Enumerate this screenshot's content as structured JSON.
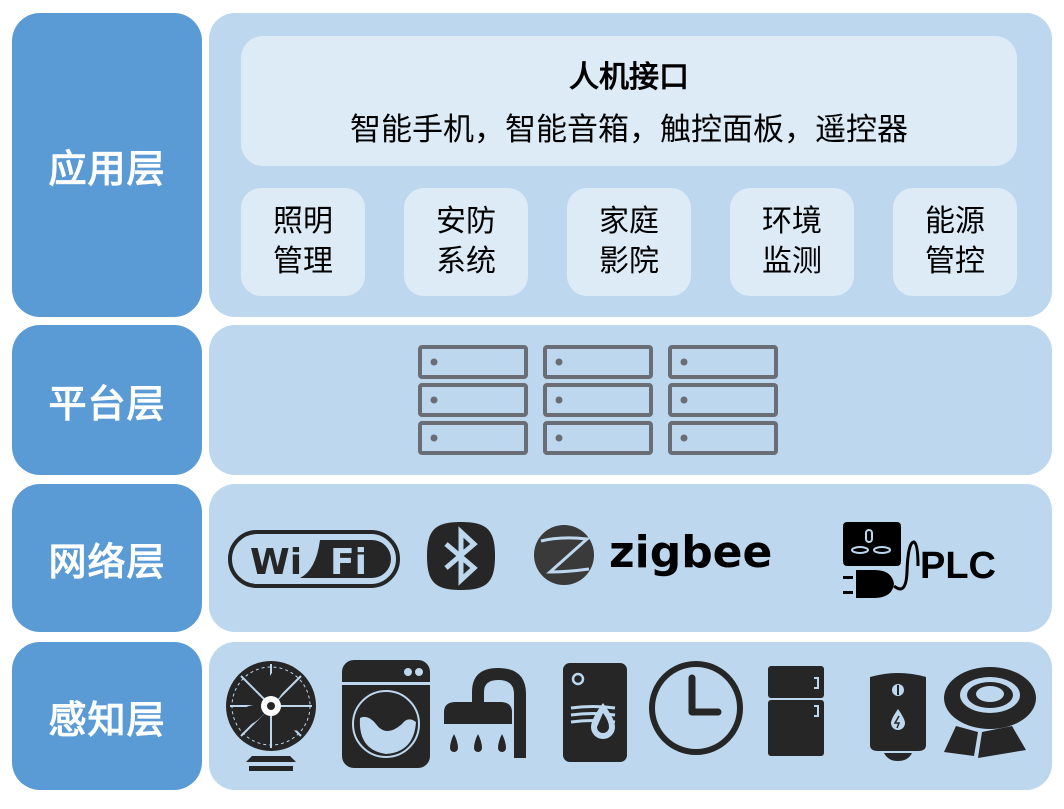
{
  "layers": [
    {
      "label": "应用层",
      "hmi": {
        "title": "人机接口",
        "devices": "智能手机，智能音箱，触控面板，遥控器"
      },
      "subsystems": [
        {
          "line1": "照明",
          "line2": "管理"
        },
        {
          "line1": "安防",
          "line2": "系统"
        },
        {
          "line1": "家庭",
          "line2": "影院"
        },
        {
          "line1": "环境",
          "line2": "监测"
        },
        {
          "line1": "能源",
          "line2": "管控"
        }
      ]
    },
    {
      "label": "平台层",
      "icons": [
        "server-rack-icon",
        "server-rack-icon",
        "server-rack-icon"
      ]
    },
    {
      "label": "网络层",
      "icons": [
        "wifi-logo-icon",
        "bluetooth-icon",
        "zigbee-logo-icon",
        "plc-icon"
      ],
      "texts": {
        "wifi_wi": "Wi",
        "wifi_fi": "Fi",
        "zigbee": "zigbee",
        "plc": "PLC"
      }
    },
    {
      "label": "感知层",
      "icons": [
        "fan-icon",
        "washing-machine-icon",
        "shower-icon",
        "humidifier-icon",
        "clock-icon",
        "refrigerator-icon",
        "water-heater-icon",
        "robot-vacuum-icon"
      ]
    }
  ],
  "colors": {
    "label_bg": "#5b9bd5",
    "panel_bg": "#bdd7ee",
    "box_bg": "#ddebf7",
    "icon_dark": "#262626",
    "server_gray": "#6b6d74"
  }
}
